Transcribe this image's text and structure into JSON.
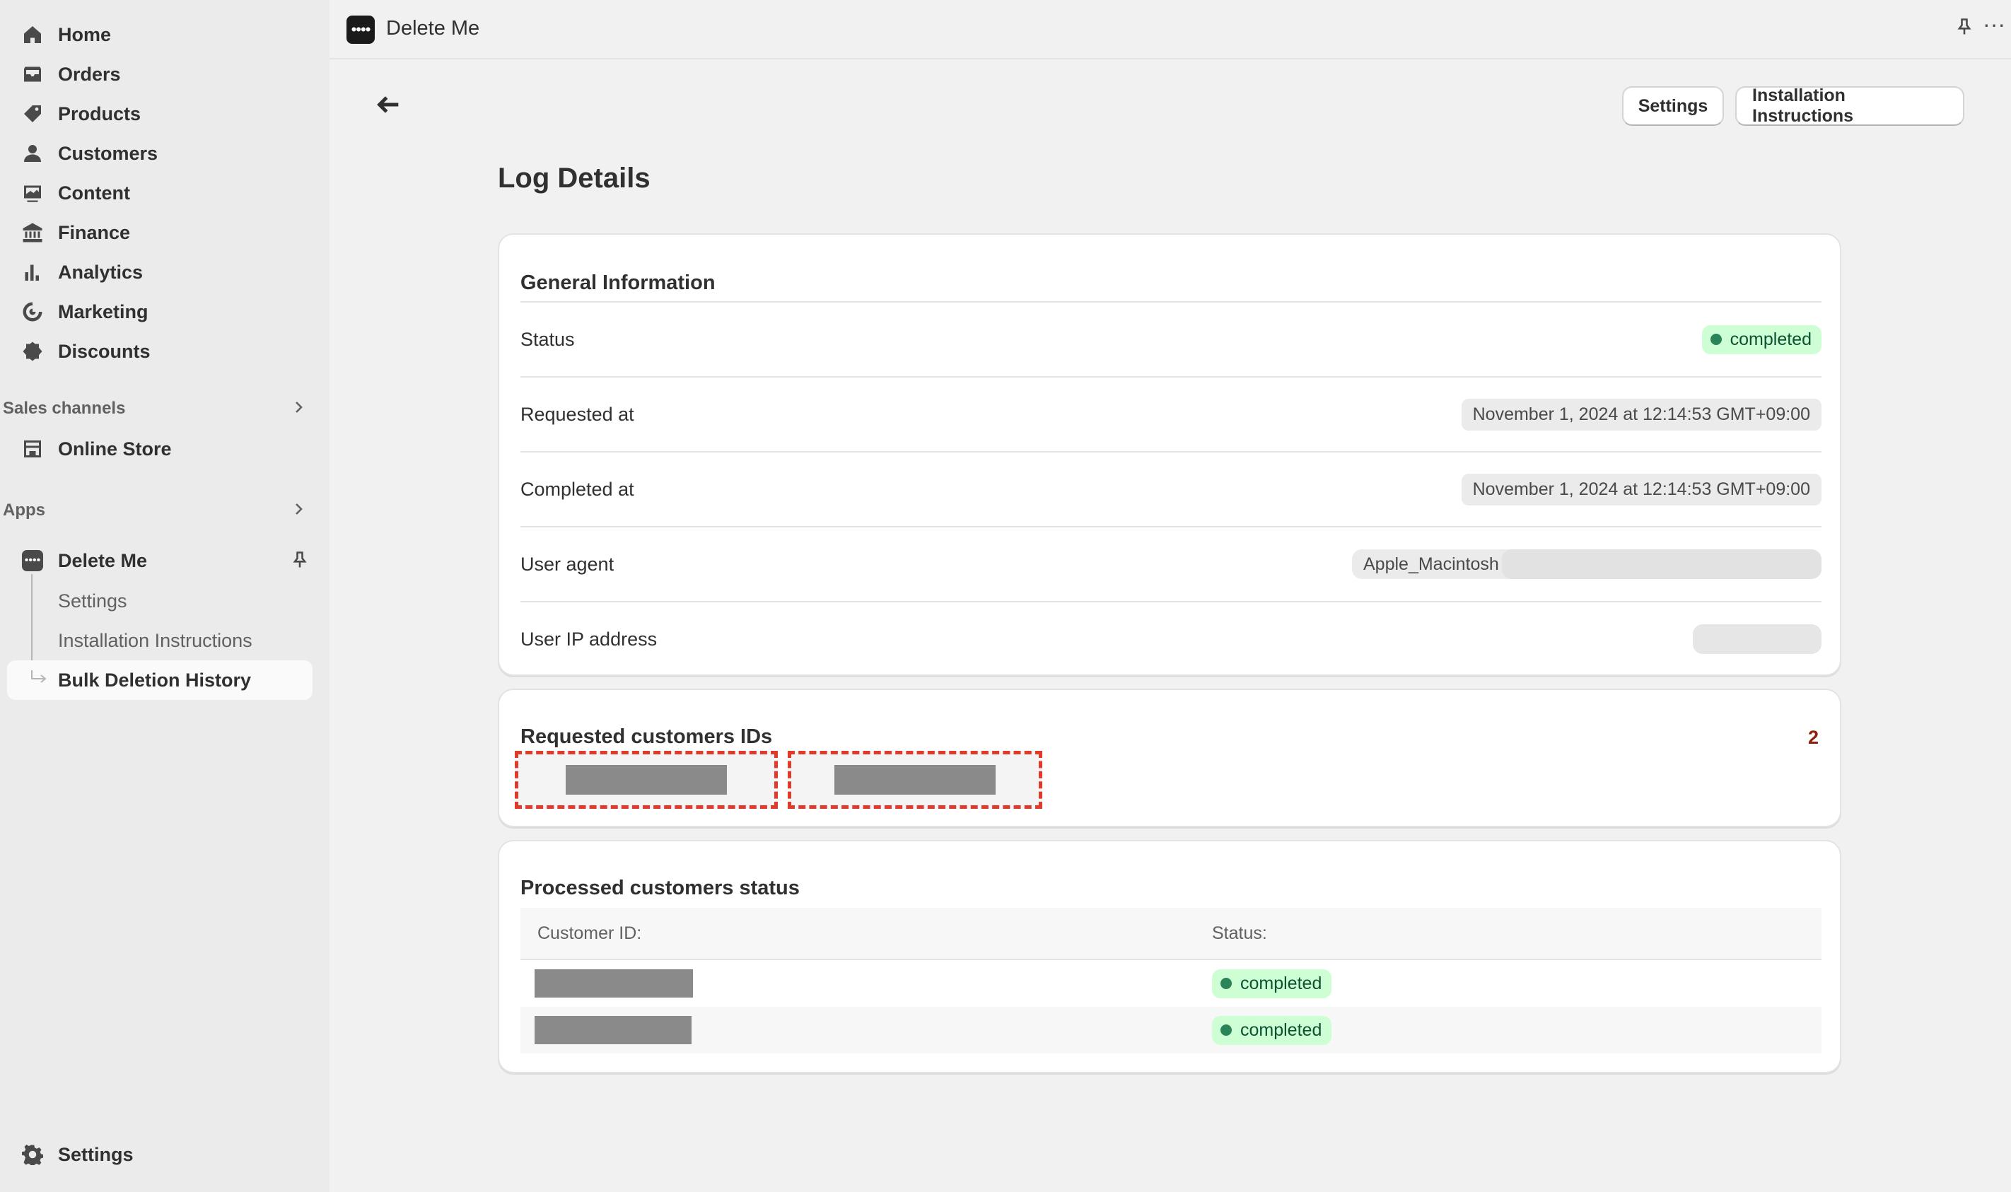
{
  "sidebar": {
    "items": [
      {
        "label": "Home",
        "icon": "home-icon"
      },
      {
        "label": "Orders",
        "icon": "inbox-icon"
      },
      {
        "label": "Products",
        "icon": "tag-icon"
      },
      {
        "label": "Customers",
        "icon": "person-icon"
      },
      {
        "label": "Content",
        "icon": "image-icon"
      },
      {
        "label": "Finance",
        "icon": "bank-icon"
      },
      {
        "label": "Analytics",
        "icon": "bar-chart-icon"
      },
      {
        "label": "Marketing",
        "icon": "target-icon"
      },
      {
        "label": "Discounts",
        "icon": "discount-icon"
      }
    ],
    "sales_channels_label": "Sales channels",
    "online_store_label": "Online Store",
    "apps_label": "Apps",
    "app": {
      "name": "Delete Me",
      "sub_items": [
        "Settings",
        "Installation Instructions",
        "Bulk Deletion History"
      ]
    },
    "settings_label": "Settings"
  },
  "topbar": {
    "title": "Delete Me",
    "more": "···"
  },
  "header": {
    "settings_button": "Settings",
    "instructions_button": "Installation Instructions",
    "page_title": "Log Details"
  },
  "general": {
    "title": "General Information",
    "status_label": "Status",
    "status_value": "completed",
    "requested_label": "Requested at",
    "requested_value": "November 1, 2024 at 12:14:53 GMT+09:00",
    "completed_label": "Completed at",
    "completed_value": "November 1, 2024 at 12:14:53 GMT+09:00",
    "user_agent_label": "User agent",
    "user_agent_value": "Apple_Macintosh",
    "ip_label": "User IP address"
  },
  "requested": {
    "title": "Requested customers IDs",
    "count": "2"
  },
  "processed": {
    "title": "Processed customers status",
    "col_customer": "Customer ID:",
    "col_status": "Status:",
    "rows": [
      {
        "status": "completed"
      },
      {
        "status": "completed"
      }
    ]
  },
  "colors": {
    "badge_bg": "#cdfed4",
    "badge_text": "#0c5132",
    "highlight_dash": "#e03a2a",
    "count": "#8e1f0b"
  }
}
